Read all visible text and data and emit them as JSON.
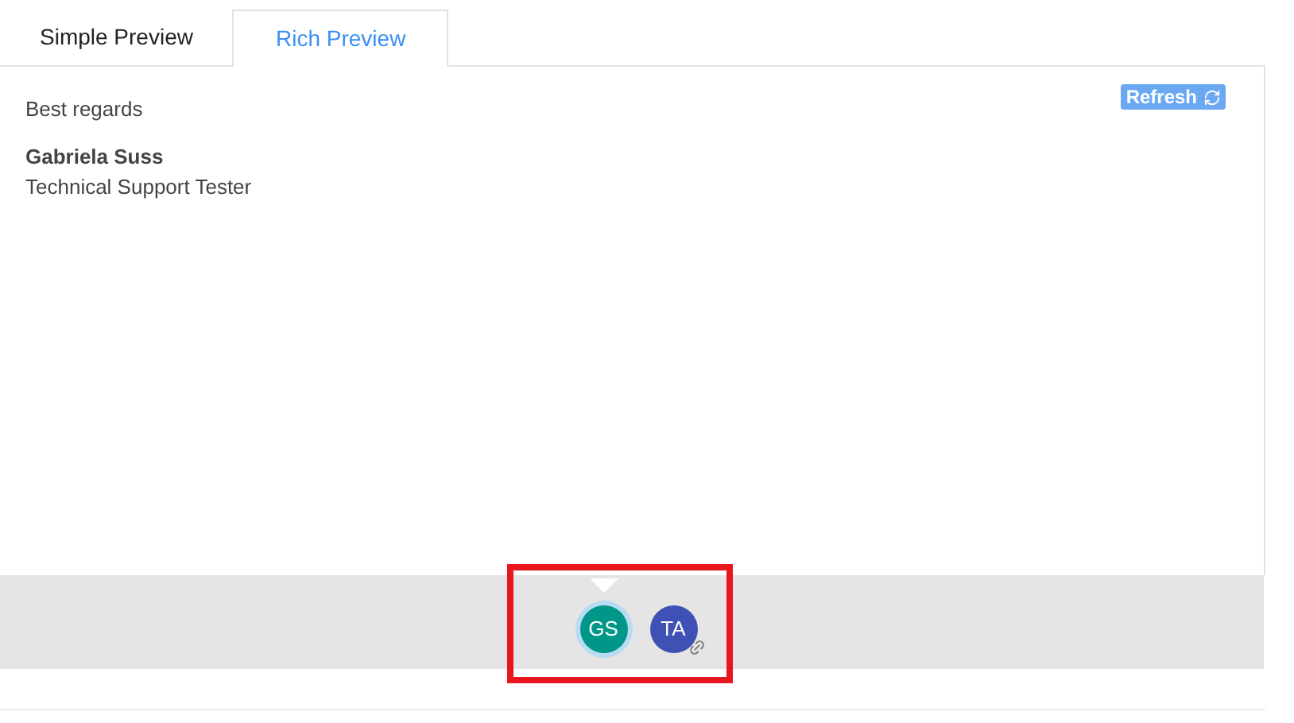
{
  "tabs": [
    {
      "label": "Simple Preview",
      "selected": false
    },
    {
      "label": "Rich Preview",
      "selected": true
    }
  ],
  "refresh_button": {
    "label": "Refresh"
  },
  "preview": {
    "closing": "Best regards",
    "name": "Gabriela Suss",
    "role": "Technical Support Tester"
  },
  "avatars": [
    {
      "initials": "GS",
      "color": "#009688",
      "selected": true,
      "linked": false
    },
    {
      "initials": "TA",
      "color": "#3f51b5",
      "selected": false,
      "linked": true
    }
  ]
}
